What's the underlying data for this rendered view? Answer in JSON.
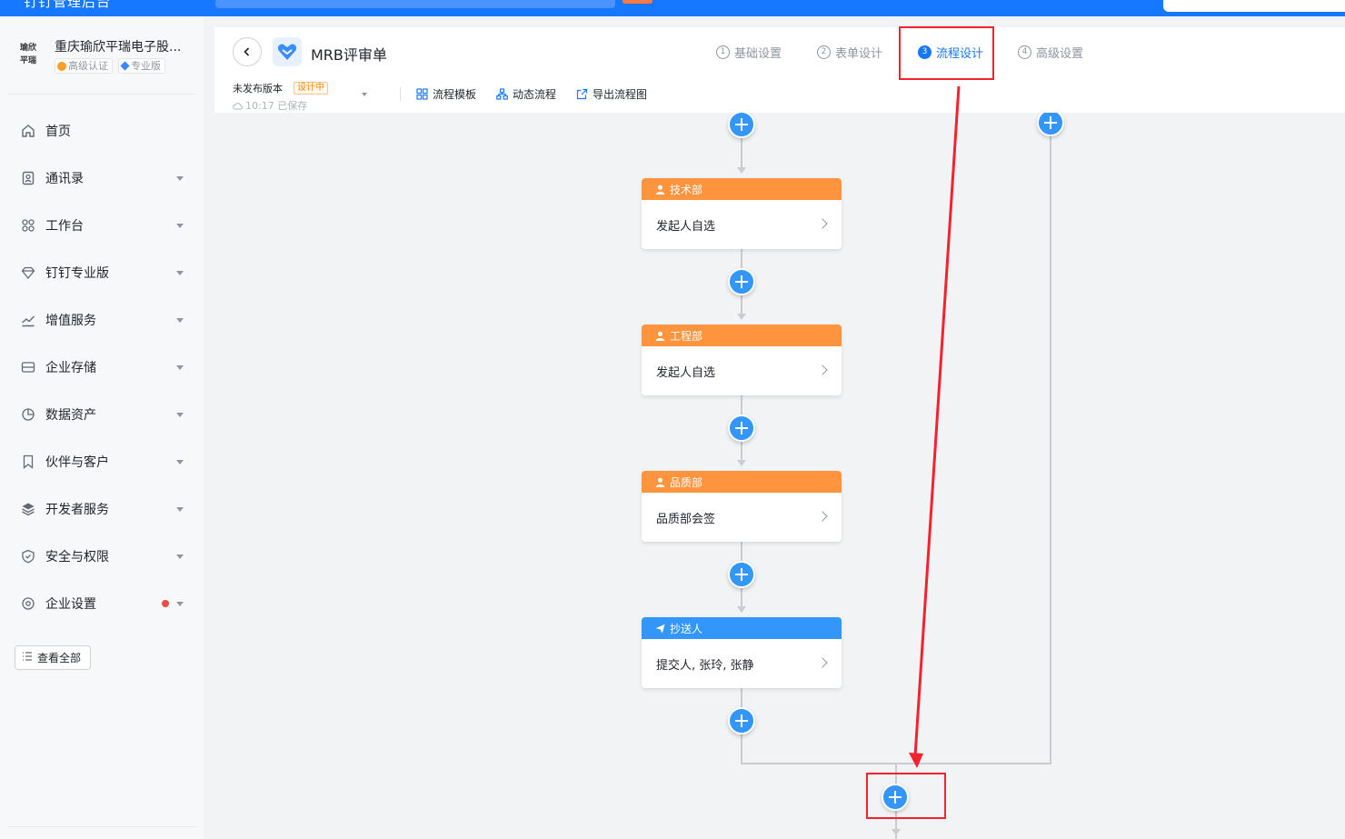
{
  "topbar": {
    "title": "钉钉管理后台"
  },
  "sidebar": {
    "org": {
      "logo_text": "瑜欣平瑞",
      "name": "重庆瑜欣平瑞电子股...",
      "badge_cert": "高级认证",
      "badge_pro": "专业版"
    },
    "items": [
      {
        "label": "首页",
        "icon": "home-icon"
      },
      {
        "label": "通讯录",
        "icon": "contacts-icon"
      },
      {
        "label": "工作台",
        "icon": "grid-icon"
      },
      {
        "label": "钉钉专业版",
        "icon": "diamond-icon"
      },
      {
        "label": "增值服务",
        "icon": "trend-icon"
      },
      {
        "label": "企业存储",
        "icon": "storage-icon"
      },
      {
        "label": "数据资产",
        "icon": "pie-icon"
      },
      {
        "label": "伙伴与客户",
        "icon": "bookmark-icon"
      },
      {
        "label": "开发者服务",
        "icon": "layers-icon"
      },
      {
        "label": "安全与权限",
        "icon": "shield-icon"
      },
      {
        "label": "企业设置",
        "icon": "gear-icon"
      }
    ],
    "view_all": "查看全部"
  },
  "header": {
    "app_title": "MRB评审单",
    "steps": [
      {
        "num": "1",
        "label": "基础设置"
      },
      {
        "num": "2",
        "label": "表单设计"
      },
      {
        "num": "3",
        "label": "流程设计"
      },
      {
        "num": "4",
        "label": "高级设置"
      }
    ],
    "version_label": "未发布版本",
    "version_tag": "设计中",
    "saved_text": "10:17 已保存",
    "toolbar": {
      "template": "流程模板",
      "dynamic": "动态流程",
      "export": "导出流程图"
    }
  },
  "flow": {
    "nodes": [
      {
        "title": "技术部",
        "content": "发起人自选",
        "kind": "approver"
      },
      {
        "title": "工程部",
        "content": "发起人自选",
        "kind": "approver"
      },
      {
        "title": "品质部",
        "content": "品质部会签",
        "kind": "approver"
      },
      {
        "title": "抄送人",
        "content": "提交人, 张玲, 张静",
        "kind": "cc"
      }
    ]
  },
  "colors": {
    "primary": "#1677ff",
    "approver_header": "#ff943e",
    "cc_header": "#3296fa",
    "annotation": "#f5222d"
  }
}
